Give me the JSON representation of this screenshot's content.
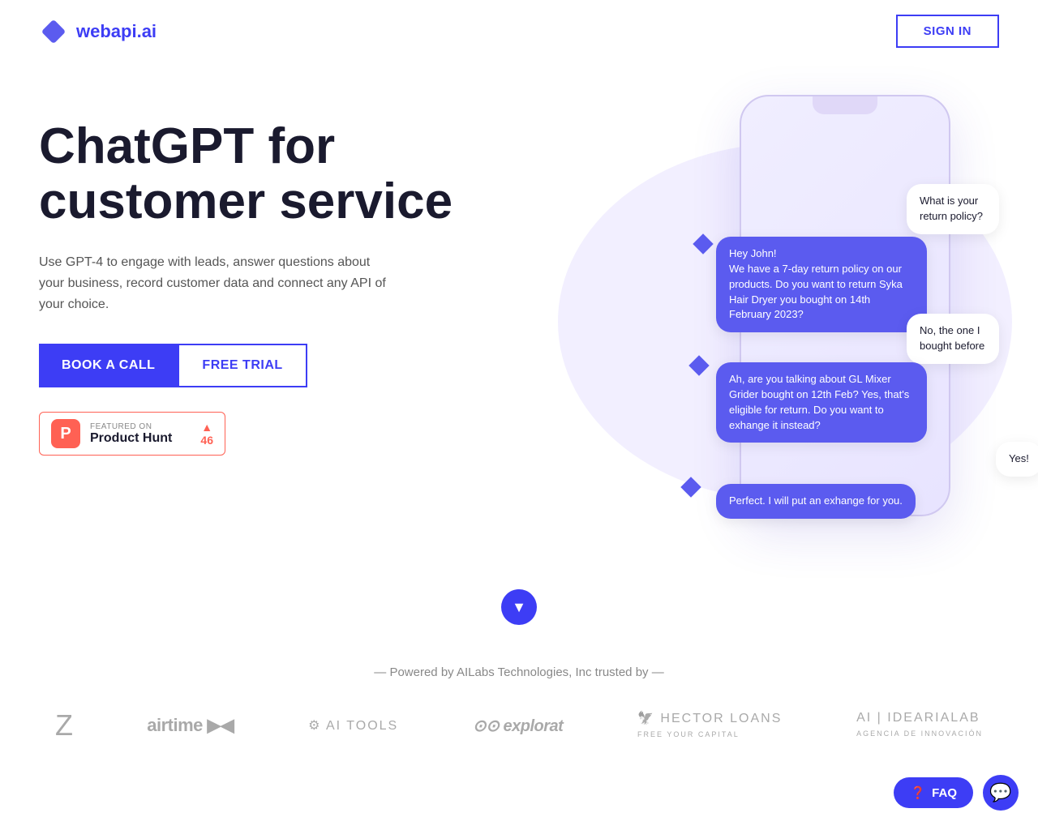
{
  "header": {
    "logo_text": "webapi",
    "logo_accent": ".ai",
    "sign_in_label": "SIGN IN"
  },
  "hero": {
    "title_line1": "ChatGPT for",
    "title_line2": "customer service",
    "subtitle": "Use GPT-4 to engage with leads, answer questions about your business, record customer data and connect any API of your choice.",
    "btn_book": "BOOK A CALL",
    "btn_trial": "FREE TRIAL"
  },
  "product_hunt": {
    "featured_label": "FEATURED ON",
    "name": "Product Hunt",
    "votes": "46"
  },
  "chat_messages": [
    {
      "text": "What is your return policy?",
      "type": "white",
      "from": "user"
    },
    {
      "text": "Hey John! We have a 7-day return policy on our products. Do you want to return Syka Hair Dryer you bought on 14th February 2023?",
      "type": "purple",
      "from": "bot"
    },
    {
      "text": "No, the one I bought before",
      "type": "white",
      "from": "user"
    },
    {
      "text": "Ah, are you talking about GL Mixer Grider bought on 12th Feb? Yes, that's eligible for return. Do you want to exhange it instead?",
      "type": "purple",
      "from": "bot"
    },
    {
      "text": "Yes!",
      "type": "white",
      "from": "user"
    },
    {
      "text": "Perfect. I will put an exhange for you.",
      "type": "purple",
      "from": "bot"
    }
  ],
  "scroll": {
    "icon": "▼"
  },
  "trusted": {
    "label": "— Powered by AILabs Technologies, Inc trusted by —",
    "logos": [
      "Z",
      "airtime ▶◀",
      "AI TOOLS",
      "explorat",
      "HECTOR LOANS",
      "AIIDEARIALAB"
    ]
  },
  "faq_btn": "FAQ",
  "chat_widget_label": "Chat"
}
